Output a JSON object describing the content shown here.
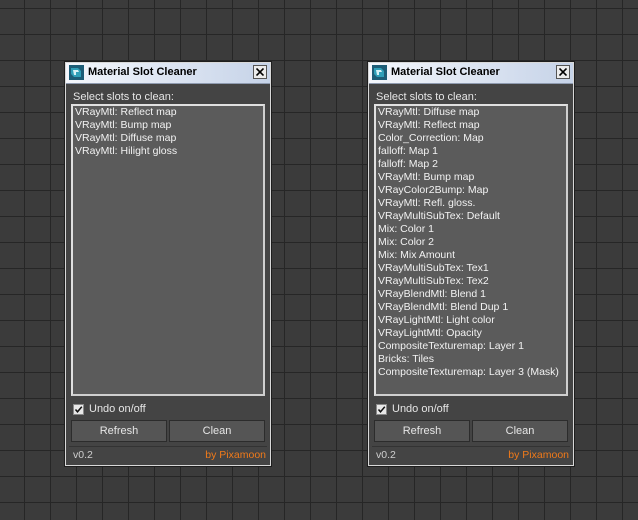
{
  "colors": {
    "viewport_bg": "#3b3b3b",
    "grid_line": "#262626",
    "panel_bg": "#444444",
    "list_bg": "#5b5b5b",
    "author_accent": "#f07a1a"
  },
  "windows": [
    {
      "title": "Material Slot Cleaner",
      "icon": "3dsmax-app-icon",
      "close_icon": "close-icon",
      "prompt": "Select slots to clean:",
      "items": [
        "VRayMtl: Reflect map",
        "VRayMtl: Bump map",
        "VRayMtl: Diffuse map",
        "VRayMtl: Hilight gloss"
      ],
      "undo_label": "Undo on/off",
      "undo_checked": true,
      "refresh_label": "Refresh",
      "clean_label": "Clean",
      "version": "v0.2",
      "author": "by Pixamoon"
    },
    {
      "title": "Material Slot Cleaner",
      "icon": "3dsmax-app-icon",
      "close_icon": "close-icon",
      "prompt": "Select slots to clean:",
      "items": [
        "VRayMtl: Diffuse map",
        "VRayMtl: Reflect map",
        "Color_Correction: Map",
        "falloff: Map 1",
        "falloff: Map 2",
        "VRayMtl: Bump map",
        "VRayColor2Bump: Map",
        "VRayMtl: Refl. gloss.",
        "VRayMultiSubTex: Default",
        "Mix: Color 1",
        "Mix: Color 2",
        "Mix: Mix Amount",
        "VRayMultiSubTex: Tex1",
        "VRayMultiSubTex: Tex2",
        "VRayBlendMtl: Blend 1",
        "VRayBlendMtl: Blend Dup 1",
        "VRayLightMtl: Light color",
        "VRayLightMtl: Opacity",
        "CompositeTexturemap:  Layer 1",
        "Bricks: Tiles",
        "CompositeTexturemap:  Layer 3 (Mask)"
      ],
      "undo_label": "Undo on/off",
      "undo_checked": true,
      "refresh_label": "Refresh",
      "clean_label": "Clean",
      "version": "v0.2",
      "author": "by Pixamoon"
    }
  ]
}
